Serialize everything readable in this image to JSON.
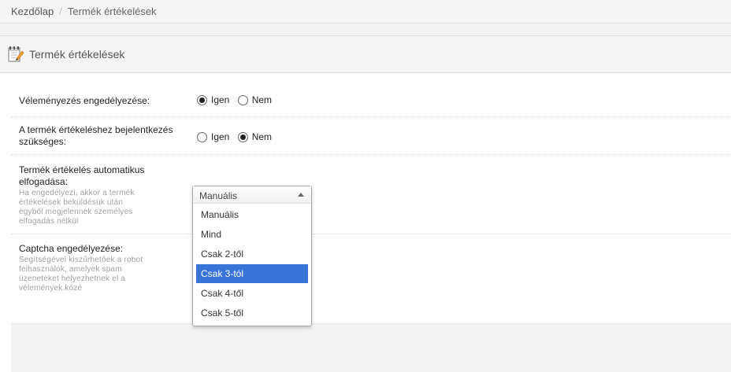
{
  "breadcrumb": {
    "home": "Kezdőlap",
    "separator": "/",
    "current": "Termék értékelések"
  },
  "panel": {
    "title": "Termék értékelések",
    "icon": "edit-document-icon"
  },
  "settings": {
    "reviews_enabled": {
      "label": "Véleményezés engedélyezése:",
      "options": [
        "Igen",
        "Nem"
      ],
      "selected": "Igen"
    },
    "login_required": {
      "label_line1": "A termék értékeléshez bejelentkezés",
      "label_line2": "szükséges:",
      "options": [
        "Igen",
        "Nem"
      ],
      "selected": "Nem"
    },
    "auto_approve": {
      "label_line1": "Termék értékelés automatikus",
      "label_line2": "elfogadása:",
      "help": [
        "Ha engedélyezi, akkor a termék",
        "értékelések beküldésük után",
        "egyből megjelennek személyes",
        "elfogadás nélkül"
      ],
      "dropdown": {
        "value": "Manuális",
        "options": [
          "Manuális",
          "Mind",
          "Csak 2-től",
          "Csak 3-tól",
          "Csak 4-től",
          "Csak 5-től"
        ],
        "highlighted": "Csak 3-tól"
      }
    },
    "captcha": {
      "label": "Captcha engedélyezése:",
      "help": [
        "Segítségével kiszűrhetőek a robot",
        "felhasználók, amelyek spam",
        "üzeneteket helyezhetnek el a",
        "vélemények közé"
      ]
    }
  }
}
